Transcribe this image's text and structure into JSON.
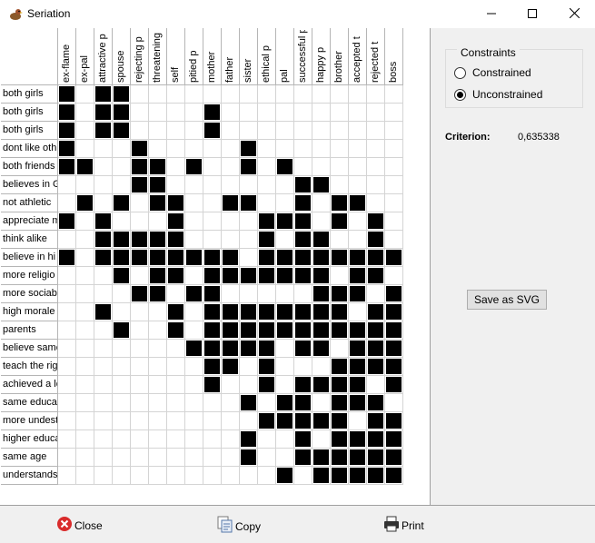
{
  "window": {
    "title": "Seriation",
    "minimize_glyph": "—",
    "maximize_glyph": "☐",
    "close_glyph": "✕"
  },
  "columns": [
    "ex-flame",
    "ex-pal",
    "attractive p",
    "spouse",
    "rejecting p",
    "threatening p",
    "self",
    "pitied p",
    "mother",
    "father",
    "sister",
    "ethical p",
    "pal",
    "successful p",
    "happy p",
    "brother",
    "accepted t",
    "rejected t",
    "boss"
  ],
  "rows": [
    {
      "label": "both girls",
      "cells": [
        1,
        0,
        1,
        1,
        0,
        0,
        0,
        0,
        0,
        0,
        0,
        0,
        0,
        0,
        0,
        0,
        0,
        0,
        0
      ]
    },
    {
      "label": "both girls",
      "cells": [
        1,
        0,
        1,
        1,
        0,
        0,
        0,
        0,
        1,
        0,
        0,
        0,
        0,
        0,
        0,
        0,
        0,
        0,
        0
      ]
    },
    {
      "label": "both girls",
      "cells": [
        1,
        0,
        1,
        1,
        0,
        0,
        0,
        0,
        1,
        0,
        0,
        0,
        0,
        0,
        0,
        0,
        0,
        0,
        0
      ]
    },
    {
      "label": "dont like oth",
      "cells": [
        1,
        0,
        0,
        0,
        1,
        0,
        0,
        0,
        0,
        0,
        1,
        0,
        0,
        0,
        0,
        0,
        0,
        0,
        0
      ]
    },
    {
      "label": "both friends",
      "cells": [
        1,
        1,
        0,
        0,
        1,
        1,
        0,
        1,
        0,
        0,
        1,
        0,
        1,
        0,
        0,
        0,
        0,
        0,
        0
      ]
    },
    {
      "label": "believes in G",
      "cells": [
        0,
        0,
        0,
        0,
        1,
        1,
        0,
        0,
        0,
        0,
        0,
        0,
        0,
        1,
        1,
        0,
        0,
        0,
        0
      ]
    },
    {
      "label": "not athletic",
      "cells": [
        0,
        1,
        0,
        1,
        0,
        1,
        1,
        0,
        0,
        1,
        1,
        0,
        0,
        1,
        0,
        1,
        1,
        0,
        0
      ]
    },
    {
      "label": "appreciate m",
      "cells": [
        1,
        0,
        1,
        0,
        0,
        0,
        1,
        0,
        0,
        0,
        0,
        1,
        1,
        1,
        0,
        1,
        0,
        1,
        0
      ]
    },
    {
      "label": "think alike",
      "cells": [
        0,
        0,
        1,
        1,
        1,
        1,
        1,
        0,
        0,
        0,
        0,
        1,
        0,
        1,
        1,
        0,
        0,
        1,
        0
      ]
    },
    {
      "label": "believe in hi",
      "cells": [
        1,
        0,
        1,
        1,
        1,
        1,
        1,
        1,
        1,
        1,
        0,
        1,
        1,
        1,
        1,
        1,
        1,
        1,
        1
      ]
    },
    {
      "label": "more religio",
      "cells": [
        0,
        0,
        0,
        1,
        0,
        1,
        1,
        0,
        1,
        1,
        1,
        1,
        1,
        1,
        1,
        0,
        1,
        1,
        0
      ]
    },
    {
      "label": "more sociab",
      "cells": [
        0,
        0,
        0,
        0,
        1,
        1,
        0,
        1,
        1,
        0,
        0,
        0,
        0,
        0,
        1,
        1,
        1,
        0,
        1
      ]
    },
    {
      "label": "high morale",
      "cells": [
        0,
        0,
        1,
        0,
        0,
        0,
        1,
        0,
        1,
        1,
        1,
        1,
        1,
        1,
        1,
        1,
        0,
        1,
        1
      ]
    },
    {
      "label": "parents",
      "cells": [
        0,
        0,
        0,
        1,
        0,
        0,
        1,
        0,
        1,
        1,
        1,
        1,
        1,
        1,
        1,
        1,
        1,
        1,
        1
      ]
    },
    {
      "label": "believe same",
      "cells": [
        0,
        0,
        0,
        0,
        0,
        0,
        0,
        1,
        1,
        1,
        1,
        1,
        0,
        1,
        1,
        0,
        1,
        1,
        1
      ]
    },
    {
      "label": "teach the rig",
      "cells": [
        0,
        0,
        0,
        0,
        0,
        0,
        0,
        0,
        1,
        1,
        0,
        1,
        0,
        0,
        0,
        1,
        1,
        1,
        1
      ]
    },
    {
      "label": "achieved a lo",
      "cells": [
        0,
        0,
        0,
        0,
        0,
        0,
        0,
        0,
        1,
        0,
        0,
        1,
        0,
        1,
        1,
        1,
        1,
        0,
        1
      ]
    },
    {
      "label": "same educat",
      "cells": [
        0,
        0,
        0,
        0,
        0,
        0,
        0,
        0,
        0,
        0,
        1,
        0,
        1,
        1,
        0,
        1,
        1,
        1,
        0
      ]
    },
    {
      "label": "more undest",
      "cells": [
        0,
        0,
        0,
        0,
        0,
        0,
        0,
        0,
        0,
        0,
        0,
        1,
        1,
        1,
        1,
        1,
        0,
        1,
        1
      ]
    },
    {
      "label": "higher educa",
      "cells": [
        0,
        0,
        0,
        0,
        0,
        0,
        0,
        0,
        0,
        0,
        1,
        0,
        0,
        1,
        0,
        1,
        1,
        1,
        1
      ]
    },
    {
      "label": "same age",
      "cells": [
        0,
        0,
        0,
        0,
        0,
        0,
        0,
        0,
        0,
        0,
        1,
        0,
        0,
        1,
        1,
        1,
        1,
        1,
        1
      ]
    },
    {
      "label": "understands",
      "cells": [
        0,
        0,
        0,
        0,
        0,
        0,
        0,
        0,
        0,
        0,
        0,
        0,
        1,
        0,
        1,
        1,
        1,
        1,
        1
      ]
    }
  ],
  "panel": {
    "constraints_title": "Constraints",
    "option_constrained": "Constrained",
    "option_unconstrained": "Unconstrained",
    "selected_option": "Unconstrained",
    "criterion_label": "Criterion:",
    "criterion_value": "0,635338",
    "save_svg_label": "Save as SVG"
  },
  "footer": {
    "close_label": "Close",
    "copy_label": "Copy",
    "print_label": "Print"
  },
  "icons": {
    "app": "bird-icon",
    "close": "close-circle-icon",
    "copy": "copy-icon",
    "print": "printer-icon"
  },
  "colors": {
    "filled_cell": "#000000",
    "close_icon": "#d92b2b"
  }
}
